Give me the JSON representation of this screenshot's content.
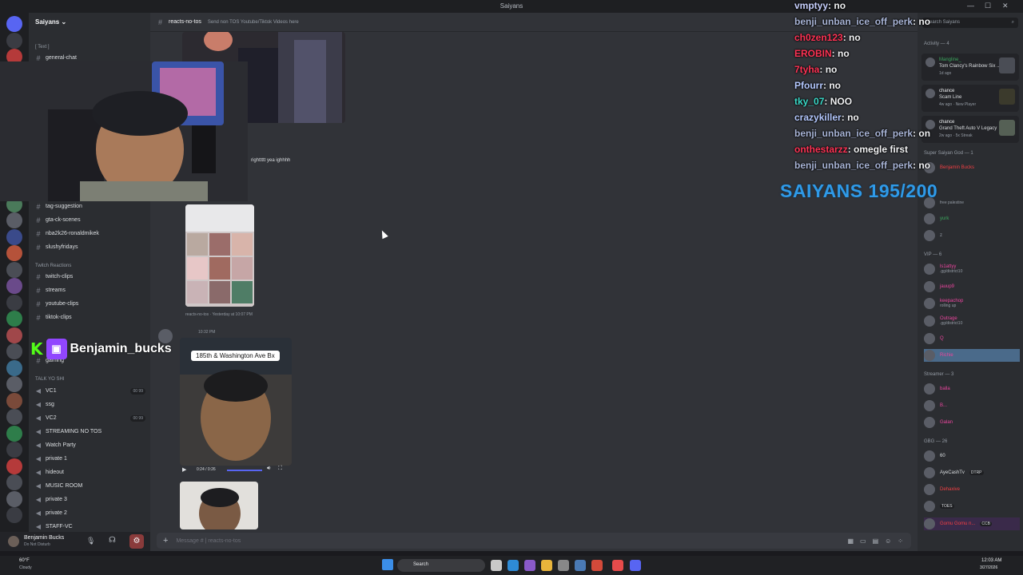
{
  "window": {
    "title": "Saiyans"
  },
  "server": {
    "name": "Saiyans"
  },
  "sidebar": {
    "cat_text": "[ Text ]",
    "general": "general-chat",
    "text_channels": [
      "tag-suggestion",
      "gta-ck-scenes",
      "nba2k26-ronaldmikek",
      "slushyfridays"
    ],
    "cat_twitch": "Twitch Reactions",
    "twitch_channels": [
      "twitch-clips",
      "streams",
      "youtube-clips",
      "tiktok-clips"
    ],
    "gaming": "gaming",
    "cat_talk": "TALK YO SHI",
    "voice_channels": [
      {
        "name": "VC1",
        "count": "00 99"
      },
      {
        "name": "ssg",
        "count": ""
      },
      {
        "name": "VC2",
        "count": "00 99"
      },
      {
        "name": "STREAMING NO TOS",
        "count": ""
      },
      {
        "name": "Watch Party",
        "count": ""
      },
      {
        "name": "private 1",
        "count": ""
      },
      {
        "name": "hideout",
        "count": ""
      },
      {
        "name": "MUSIC ROOM",
        "count": ""
      },
      {
        "name": "private 3",
        "count": ""
      },
      {
        "name": "private 2",
        "count": ""
      },
      {
        "name": "STAFF-VC",
        "count": ""
      }
    ]
  },
  "user": {
    "name": "Benjamin Bucks",
    "status": "Do Not Disturb"
  },
  "chat": {
    "channel": "reacts-no-tos",
    "topic": "Send non TOS Youtube/Tiktok Videos here",
    "msg1": "righttttt yea ighhhh",
    "thread_meta": "reacts-no-tos · Yesterday at 10:07 PM",
    "time2": "10:32 PM",
    "video_caption": "185th & Washington Ave Bx",
    "video_time": "0:24 / 0:26",
    "composer_placeholder": "Message #  |  reacts-no-tos"
  },
  "overlay": {
    "messages": [
      {
        "user": "vmptyy",
        "text": "no",
        "color": "#c9d1ff"
      },
      {
        "user": "benji_unban_ice_off_perk",
        "text": "no",
        "color": "#a8b4d6"
      },
      {
        "user": "ch0zen123",
        "text": "no",
        "color": "#ff3355"
      },
      {
        "user": "EROBIN",
        "text": "no",
        "color": "#ff3355"
      },
      {
        "user": "7tyha",
        "text": "no",
        "color": "#ff3355"
      },
      {
        "user": "Pfourr",
        "text": "no",
        "color": "#b5c9ff"
      },
      {
        "user": "tky_07",
        "text": "NOO",
        "color": "#3ad9c8"
      },
      {
        "user": "crazykiller",
        "text": "no",
        "color": "#b5c9ff"
      },
      {
        "user": "benji_unban_ice_off_perk",
        "text": "on",
        "color": "#a8b4d6"
      },
      {
        "user": "onthestarzz",
        "text": "omegle first",
        "color": "#ff3355"
      },
      {
        "user": "benji_unban_ice_off_perk",
        "text": "no",
        "color": "#a8b4d6"
      }
    ],
    "subgoal": "SAIYANS 195/200",
    "streamer_name": "Benjamin_bucks"
  },
  "members": {
    "search_placeholder": "Search Saiyans",
    "activity_header": "Activity — 4",
    "activities": [
      {
        "name": "Mangline_",
        "detail": "Tom Clancy's Rainbow Six ...",
        "sub": "1d ago"
      },
      {
        "name": "chance",
        "detail": "Scam Line",
        "sub": "4w ago · New Player"
      },
      {
        "name": "chance",
        "detail": "Grand Theft Auto V Legacy",
        "sub": "2w ago · 5x Streak"
      }
    ],
    "group_god": "Super Saiyan God — 1",
    "god_member": "Benjamin Bucks",
    "misc_members": [
      {
        "name": "free palestine",
        "color": "#949ba4"
      },
      {
        "name": "yurk",
        "color": "#3ba55d"
      },
      {
        "name": "z",
        "color": "#949ba4"
      }
    ],
    "group_vip": "VIP — 6",
    "vip_members": [
      {
        "name": "ls1attyy",
        "sub": ".gg/district10",
        "color": "#eb459e"
      },
      {
        "name": "jauup9",
        "sub": "",
        "color": "#eb459e"
      },
      {
        "name": "keepachop",
        "sub": "rolling up",
        "color": "#eb459e"
      },
      {
        "name": "Outrage",
        "sub": ".gg/district10",
        "color": "#eb459e"
      },
      {
        "name": "Q",
        "sub": "",
        "color": "#eb459e"
      },
      {
        "name": "Richie",
        "sub": "",
        "color": "#eb459e"
      }
    ],
    "group_streamer": "Streamer — 3",
    "streamer_members": [
      "balla",
      "B...",
      "Galan"
    ],
    "group_gbg": "GBG — 26",
    "gbg_members": [
      {
        "name": "60",
        "color": "#dbdee1",
        "tag": ""
      },
      {
        "name": "AyeCashTv",
        "color": "#dbdee1",
        "tag": "DTRP"
      },
      {
        "name": "Dehaxive",
        "color": "#f23f43",
        "tag": ""
      },
      {
        "name": "",
        "color": "#dbdee1",
        "tag": "TOES"
      },
      {
        "name": "Gomu Gomu n...",
        "color": "#f23f43",
        "tag": "CCB"
      }
    ]
  },
  "taskbar": {
    "weather_temp": "60°F",
    "weather_desc": "Cloudy",
    "search": "Search",
    "time": "12:03 AM",
    "date": "3/27/2026"
  }
}
